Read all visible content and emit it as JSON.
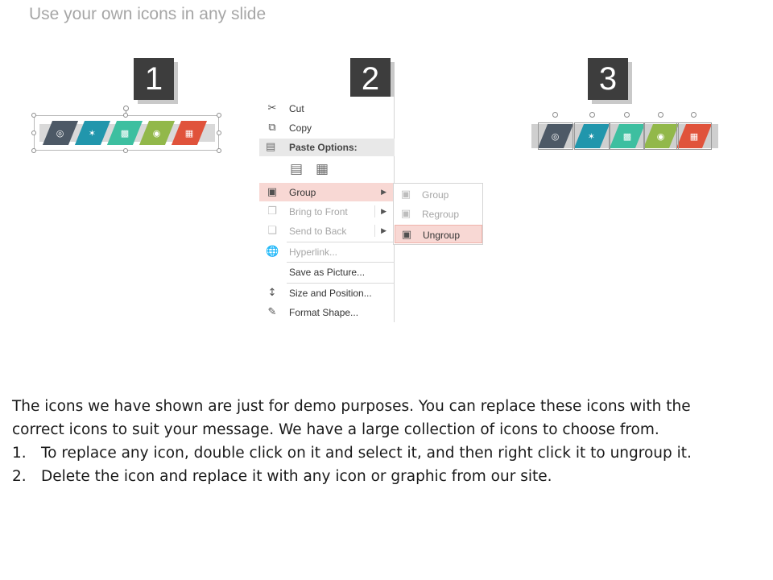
{
  "slide": {
    "title": "Use your own icons in any slide"
  },
  "steps": [
    "1",
    "2",
    "3"
  ],
  "palette": {
    "slate": "#4d5966",
    "teal": "#2196ac",
    "mint": "#3dbfa0",
    "lime": "#92b84a",
    "red": "#e0533b",
    "menu_hover": "#f8d8d4"
  },
  "icons": [
    "lightbulb-icon",
    "handshake-icon",
    "bar-chart-icon",
    "target-icon",
    "calendar-icon"
  ],
  "context_menu": {
    "cut": "Cut",
    "copy": "Copy",
    "paste_options": "Paste Options:",
    "group": "Group",
    "bring_to_front": "Bring to Front",
    "send_to_back": "Send to Back",
    "hyperlink": "Hyperlink...",
    "save_as_picture": "Save as Picture...",
    "size_and_position": "Size and Position...",
    "format_shape": "Format Shape..."
  },
  "submenu": {
    "group": "Group",
    "regroup": "Regroup",
    "ungroup": "Ungroup"
  },
  "instructions": {
    "intro": "The icons we have shown are just for demo purposes. You can replace these icons with the correct icons to suit your message. We have a large collection of icons to choose from.",
    "items": [
      {
        "num": "1.",
        "text": "To replace any icon, double click on it and select it, and then right click it to ungroup it."
      },
      {
        "num": "2.",
        "text": "Delete the icon and replace it with any icon or graphic from our site."
      }
    ]
  }
}
